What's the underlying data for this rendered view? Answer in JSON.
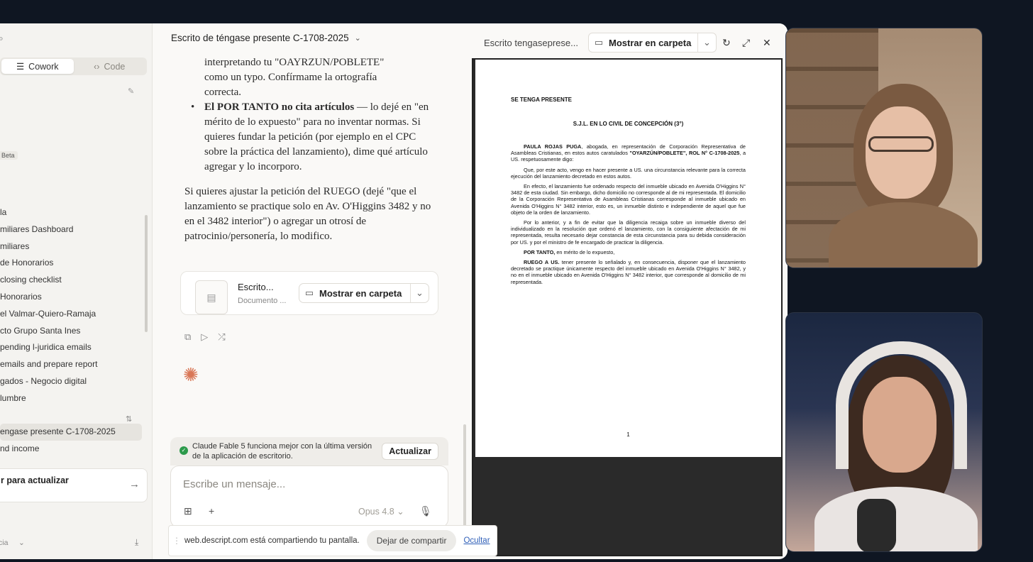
{
  "sidebar": {
    "search_glyph": "Q",
    "modes": [
      {
        "label": "Cowork",
        "icon": "☰"
      },
      {
        "label": "Code",
        "icon": "‹›"
      }
    ],
    "beta": "Beta",
    "items": [
      "la",
      "miliares Dashboard",
      "miliares",
      "de Honorarios",
      "closing checklist",
      "Honorarios",
      "el Valmar-Quiero-Ramaja",
      "cto Grupo Santa Ines",
      "pending l-juridica emails",
      "emails and prepare report",
      "gados - Negocio digital",
      "lumbre",
      "",
      "engase presente C-1708-2025",
      "nd income"
    ],
    "active_index": 13,
    "update_card": "r para actualizar",
    "bottom_left": "cia"
  },
  "chat": {
    "title": "Escrito de téngase presente C-1708-2025",
    "line1": "interpretando tu \"OAYRZUN/POBLETE\"",
    "line2": "como un typo. Confírmame la ortografía",
    "line3": "correcta.",
    "bullet_bold": "El POR TANTO no cita artículos",
    "bullet_rest": " — lo dejé en \"en mérito de lo expuesto\" para no inventar normas. Si quieres fundar la petición (por ejemplo en el CPC sobre la práctica del lanzamiento), dime qué artículo agregar y lo incorporo.",
    "paragraph": "Si quieres ajustar la petición del RUEGO (dejé \"que el lanzamiento se practique solo en Av. O'Higgins 3482 y no en el 3482 interior\") o agregar un otrosí de patrocinio/personería, lo modifico.",
    "file": {
      "name": "Escrito...",
      "type": "Documento ...",
      "folder_button": "Mostrar en carpeta"
    }
  },
  "notice": {
    "message": "Claude Fable 5 funciona mejor con la última versión de la aplicación de escritorio.",
    "button": "Actualizar"
  },
  "composer": {
    "placeholder": "Escribe un mensaje...",
    "model": "Opus 4.8"
  },
  "share": {
    "message": "web.descript.com está compartiendo tu pantalla.",
    "stop": "Dejar de compartir",
    "hide": "Ocultar"
  },
  "viewer": {
    "title": "Escrito tengasepresе...",
    "folder_button": "Mostrar en carpeta"
  },
  "document": {
    "heading": "SE TENGA PRESENTE",
    "court": "S.J.L. EN LO CIVIL DE CONCEPCIÓN (3°)",
    "p1_bold": "PAULA ROJAS PUGA",
    "p1_text": ", abogada, en representación de Corporación Representativa de Asambleas Cristianas, en estos autos caratulados ",
    "p1_bold2": "\"OYARZÚN/POBLETE\", ROL N° C-1708-2025",
    "p1_end": ", a US. respetuosamente digo:",
    "p2": "Que, por este acto, vengo en hacer presente a US. una circunstancia relevante para la correcta ejecución del lanzamiento decretado en estos autos.",
    "p3": "En efecto, el lanzamiento fue ordenado respecto del inmueble ubicado en Avenida O'Higgins N° 3482 de esta ciudad. Sin embargo, dicho domicilio no corresponde al de mi representada. El domicilio de la Corporación Representativa de Asambleas Cristianas corresponde al inmueble ubicado en Avenida O'Higgins N° 3482 interior, esto es, un inmueble distinto e independiente de aquel que fue objeto de la orden de lanzamiento.",
    "p4": "Por lo anterior, y a fin de evitar que la diligencia recaiga sobre un inmueble diverso del individualizado en la resolución que ordenó el lanzamiento, con la consiguiente afectación de mi representada, resulta necesario dejar constancia de esta circunstancia para su debida consideración por US. y por el ministro de fe encargado de practicar la diligencia.",
    "p5_bold": "POR TANTO,",
    "p5_text": " en mérito de lo expuesto,",
    "p6_bold": "RUEGO A US.",
    "p6_text": " tener presente lo señalado y, en consecuencia, disponer que el lanzamiento decretado se practique únicamente respecto del inmueble ubicado en Avenida O'Higgins N° 3482, y no en el inmueble ubicado en Avenida O'Higgins N° 3482 interior, que corresponde al domicilio de mi representada.",
    "page_number": "1"
  },
  "colors": {
    "accent_spark": "#d97757",
    "ok_green": "#2c9a4b",
    "link_blue": "#2f5fb8"
  }
}
